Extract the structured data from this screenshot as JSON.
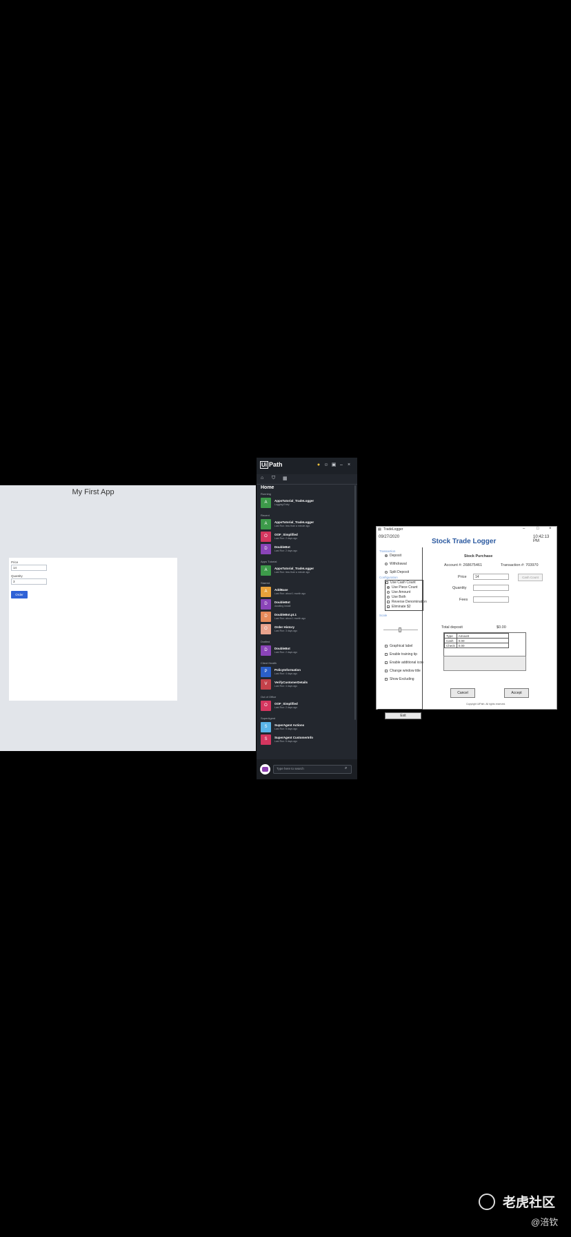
{
  "app1": {
    "title": "My First App",
    "price_label": "Price",
    "price_value": "14",
    "quantity_label": "Quantity",
    "quantity_value": "3",
    "order_button": "Order"
  },
  "uipath": {
    "logo_text": "Path",
    "logo_box": "Ui",
    "home_title": "Home",
    "search_placeholder": "Type here to search",
    "sections": [
      {
        "title": "Running",
        "items": [
          {
            "letter": "A",
            "color": "#3d9a4a",
            "name": "AppsTutorial_TradeLogger",
            "sub": "Logging Entry"
          }
        ]
      },
      {
        "title": "Recent",
        "items": [
          {
            "letter": "A",
            "color": "#3d9a4a",
            "name": "AppsTutorial_TradeLogger",
            "sub": "Last Run: less than a minute ago"
          },
          {
            "letter": "O",
            "color": "#d4365f",
            "name": "OOF_Simplified",
            "sub": "Last Run: 2 days ago"
          },
          {
            "letter": "D",
            "color": "#8a44b8",
            "name": "DoubleBot",
            "sub": "Last Run: 2 days ago"
          }
        ]
      },
      {
        "title": "Apps Tutorial",
        "items": [
          {
            "letter": "A",
            "color": "#3d9a4a",
            "name": "AppsTutorial_TradeLogger",
            "sub": "Last Run: less than a minute ago"
          }
        ]
      },
      {
        "title": "Starred",
        "items": [
          {
            "letter": "A",
            "color": "#e8a13a",
            "name": "AddBase",
            "sub": "Last Run: about 1 month ago"
          },
          {
            "letter": "D",
            "color": "#8a44b8",
            "name": "DoubleBot",
            "sub": "Awaiting Install"
          },
          {
            "letter": "D",
            "color": "#e58a5a",
            "name": "DoubleBot.pt.1",
            "sub": "Last Run: about 1 month ago"
          },
          {
            "letter": "O",
            "color": "#e8a28c",
            "name": "Order History",
            "sub": "Last Run: 3 days ago"
          }
        ]
      },
      {
        "title": "Drafted",
        "items": [
          {
            "letter": "D",
            "color": "#8a44b8",
            "name": "DoubleBot",
            "sub": "Last Run: 2 days ago"
          }
        ]
      },
      {
        "title": "Client Health",
        "items": [
          {
            "letter": "P",
            "color": "#2b5fc8",
            "name": "PolicyInformation",
            "sub": "Last Run: 4 days ago"
          },
          {
            "letter": "V",
            "color": "#c4414a",
            "name": "VerifyCustomerDetails",
            "sub": "Last Run: 4 days ago"
          }
        ]
      },
      {
        "title": "Out of Office",
        "items": [
          {
            "letter": "O",
            "color": "#d4365f",
            "name": "OOF_Simplified",
            "sub": "Last Run: 2 days ago"
          }
        ]
      },
      {
        "title": "SuperAgent",
        "items": [
          {
            "letter": "S",
            "color": "#5ab4e8",
            "name": "SuperAgent Actions",
            "sub": "Last Run: 5 days ago"
          },
          {
            "letter": "S",
            "color": "#d4365f",
            "name": "SuperAgent CustomerInfo",
            "sub": "Last Run: 5 days ago"
          }
        ]
      }
    ]
  },
  "stl": {
    "window_title": "TradeLogger",
    "date": "09/27/2020",
    "time": "10:42:13 PM",
    "heading": "Stock Trade Logger",
    "transaction_group": "Transaction",
    "opt_deposit": "Deposit",
    "opt_withdrawal": "Withdrawal",
    "opt_split": "Split Deposit",
    "configuration_group": "Configuration",
    "use_cash_count": "Use Cash Count",
    "use_piece_count": "Use Piece Count",
    "use_amount": "Use Amount",
    "use_both": "Use Both",
    "reverse_denomination": "Reverse Denomination",
    "eliminate_s2": "Eliminate $2",
    "scale_group": "Scale",
    "graphical_label": "Graphical label",
    "enable_training_tip": "Enable training tip",
    "enable_additional_icon": "Enable additional icon",
    "change_window_title": "Change window title",
    "show_excluding": "Show Excluding",
    "exit_button": "Exit",
    "sub_heading": "Stock Purchase",
    "account": "Account #: 268675461",
    "transaction_no": "Transaction #: 703970",
    "price_label": "Price",
    "price_value": "14",
    "quantity_label": "Quantity",
    "fees_label": "Fees",
    "cash_count_button": "Cash Count",
    "total_deposit_label": "Total deposit",
    "total_deposit_value": "$0.00",
    "table_headers": [
      "Type",
      "Amount"
    ],
    "table_rows": [
      [
        "Cash",
        "0.00"
      ],
      [
        "Check",
        "0.00"
      ]
    ],
    "cancel_button": "Cancel",
    "accept_button": "Accept",
    "copyright": "Copyright UiPath. All rights reserved."
  },
  "watermark": {
    "brand": "老虎社区",
    "user": "@涪钦"
  }
}
